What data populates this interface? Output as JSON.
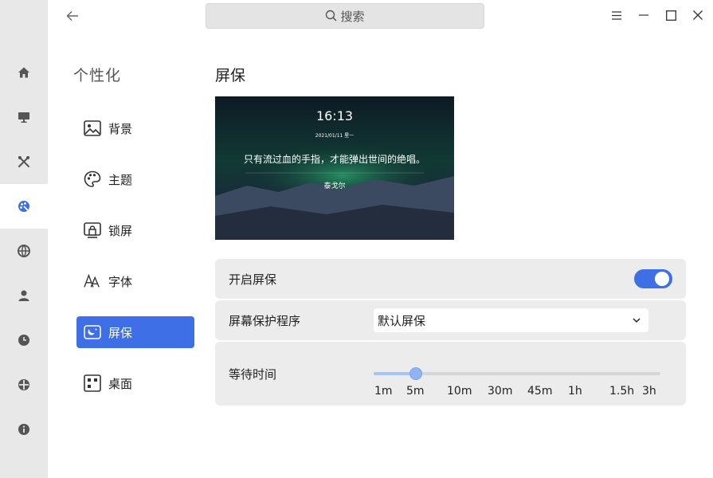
{
  "search": {
    "placeholder": "搜索"
  },
  "sidebar_rail": {
    "items": [
      {
        "icon": "home-icon"
      },
      {
        "icon": "monitor-icon"
      },
      {
        "icon": "tools-icon"
      },
      {
        "icon": "personalize-icon",
        "active": true
      },
      {
        "icon": "globe-icon"
      },
      {
        "icon": "user-icon"
      },
      {
        "icon": "clock-icon"
      },
      {
        "icon": "update-icon"
      },
      {
        "icon": "info-icon"
      }
    ]
  },
  "category": {
    "title": "个性化",
    "items": [
      {
        "label": "背景",
        "icon": "image-icon"
      },
      {
        "label": "主题",
        "icon": "palette-icon"
      },
      {
        "label": "锁屏",
        "icon": "lockscreen-icon"
      },
      {
        "label": "字体",
        "icon": "font-icon"
      },
      {
        "label": "屏保",
        "icon": "screensaver-icon",
        "active": true
      },
      {
        "label": "桌面",
        "icon": "desktop-icon"
      }
    ]
  },
  "main": {
    "title": "屏保",
    "preview": {
      "time": "16:13",
      "date": "2021/01/11 星一",
      "quote": "只有流过血的手指，才能弹出世间的绝唱。",
      "author": "泰戈尔"
    },
    "enable": {
      "label": "开启屏保",
      "value": true
    },
    "program": {
      "label": "屏幕保护程序",
      "value": "默认屏保"
    },
    "wait": {
      "label": "等待时间",
      "ticks": [
        "1m",
        "5m",
        "10m",
        "30m",
        "45m",
        "1h",
        "1.5h",
        "3h"
      ],
      "selected": "5m"
    }
  },
  "colors": {
    "accent": "#3f6fe6",
    "rail_bg": "#e8e8e8",
    "card_bg": "#ececec"
  }
}
